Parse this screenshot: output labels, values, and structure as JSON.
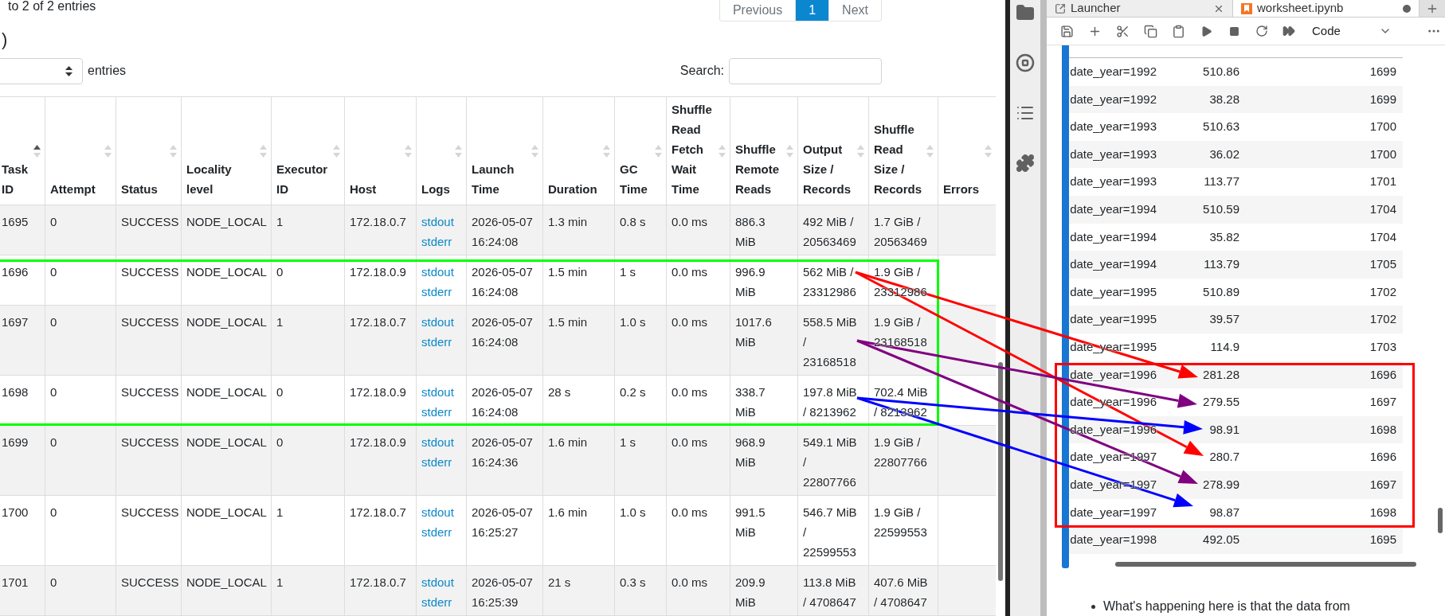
{
  "info": "to 2 of 2 entries",
  "pagination": [
    {
      "label": "Previous",
      "selected": false
    },
    {
      "label": "1",
      "selected": true
    },
    {
      "label": "Next",
      "selected": false
    }
  ],
  "heading": ")",
  "length_label": "entries",
  "search": {
    "label": "Search:"
  },
  "table": {
    "columns": [
      {
        "label": "Task ID",
        "kind": "text",
        "sorted": true
      },
      {
        "label": "Attempt",
        "kind": "text",
        "sorted": false
      },
      {
        "label": "Status",
        "kind": "text",
        "sorted": false
      },
      {
        "label": "Locality level",
        "kind": "text",
        "sorted": false
      },
      {
        "label": "Executor ID",
        "kind": "text",
        "sorted": false
      },
      {
        "label": "Host",
        "kind": "text",
        "sorted": false
      },
      {
        "label": "Logs",
        "kind": "links",
        "sorted": false
      },
      {
        "label": "Launch Time",
        "kind": "text",
        "sorted": false
      },
      {
        "label": "Duration",
        "kind": "text",
        "sorted": false
      },
      {
        "label": "GC Time",
        "kind": "text",
        "sorted": false
      },
      {
        "label": "Shuffle Read Fetch Wait Time",
        "kind": "text",
        "sorted": false
      },
      {
        "label": "Shuffle Remote Reads",
        "kind": "text",
        "sorted": false
      },
      {
        "label": "Output Size / Records",
        "kind": "text",
        "sorted": false
      },
      {
        "label": "Shuffle Read Size / Records",
        "kind": "text",
        "sorted": false
      },
      {
        "label": "Errors",
        "kind": "text",
        "sorted": false
      }
    ],
    "rows": [
      {
        "cells": [
          "1695",
          "0",
          "SUCCESS",
          "NODE_LOCAL",
          "1",
          "172.18.0.7",
          [
            "stdout",
            "stderr"
          ],
          "2026-05-07 16:24:08",
          "1.3 min",
          "0.8 s",
          "0.0 ms",
          "886.3 MiB",
          "492 MiB / 20563469",
          "1.7 GiB / 20563469"
        ]
      },
      {
        "cells": [
          "1696",
          "0",
          "SUCCESS",
          "NODE_LOCAL",
          "0",
          "172.18.0.9",
          [
            "stdout",
            "stderr"
          ],
          "2026-05-07 16:24:08",
          "1.5 min",
          "1 s",
          "0.0 ms",
          "996.9 MiB",
          "562 MiB / 23312986",
          "1.9 GiB / 23312986"
        ]
      },
      {
        "cells": [
          "1697",
          "0",
          "SUCCESS",
          "NODE_LOCAL",
          "1",
          "172.18.0.7",
          [
            "stdout",
            "stderr"
          ],
          "2026-05-07 16:24:08",
          "1.5 min",
          "1.0 s",
          "0.0 ms",
          "1017.6 MiB",
          "558.5 MiB / 23168518",
          "1.9 GiB / 23168518"
        ]
      },
      {
        "cells": [
          "1698",
          "0",
          "SUCCESS",
          "NODE_LOCAL",
          "0",
          "172.18.0.9",
          [
            "stdout",
            "stderr"
          ],
          "2026-05-07 16:24:08",
          "28 s",
          "0.2 s",
          "0.0 ms",
          "338.7 MiB",
          "197.8 MiB / 8213962",
          "702.4 MiB / 8213962"
        ]
      },
      {
        "cells": [
          "1699",
          "0",
          "SUCCESS",
          "NODE_LOCAL",
          "0",
          "172.18.0.9",
          [
            "stdout",
            "stderr"
          ],
          "2026-05-07 16:24:36",
          "1.6 min",
          "1 s",
          "0.0 ms",
          "968.9 MiB",
          "549.1 MiB / 22807766",
          "1.9 GiB / 22807766"
        ]
      },
      {
        "cells": [
          "1700",
          "0",
          "SUCCESS",
          "NODE_LOCAL",
          "1",
          "172.18.0.7",
          [
            "stdout",
            "stderr"
          ],
          "2026-05-07 16:25:27",
          "1.6 min",
          "1.0 s",
          "0.0 ms",
          "991.5 MiB",
          "546.7 MiB / 22599553",
          "1.9 GiB / 22599553"
        ]
      },
      {
        "cells": [
          "1701",
          "0",
          "SUCCESS",
          "NODE_LOCAL",
          "1",
          "172.18.0.7",
          [
            "stdout",
            "stderr"
          ],
          "2026-05-07 16:25:39",
          "21 s",
          "0.3 s",
          "0.0 ms",
          "209.9 MiB",
          "113.8 MiB / 4708647",
          "407.6 MiB / 4708647"
        ]
      }
    ]
  },
  "notebook": {
    "tabs": [
      {
        "label": "Launcher",
        "kind": "launcher",
        "selected": false,
        "unsaved": false
      },
      {
        "label": "worksheet.ipynb",
        "kind": "notebook",
        "selected": true,
        "unsaved": true
      }
    ],
    "toolbar": {
      "cell_type": "Code"
    },
    "rows": [
      {
        "partition": "date_year=1992",
        "size": "510.86",
        "task": "1699"
      },
      {
        "partition": "date_year=1992",
        "size": "38.28",
        "task": "1699"
      },
      {
        "partition": "date_year=1993",
        "size": "510.63",
        "task": "1700"
      },
      {
        "partition": "date_year=1993",
        "size": "36.02",
        "task": "1700"
      },
      {
        "partition": "date_year=1993",
        "size": "113.77",
        "task": "1701"
      },
      {
        "partition": "date_year=1994",
        "size": "510.59",
        "task": "1704"
      },
      {
        "partition": "date_year=1994",
        "size": "35.82",
        "task": "1704"
      },
      {
        "partition": "date_year=1994",
        "size": "113.79",
        "task": "1705"
      },
      {
        "partition": "date_year=1995",
        "size": "510.89",
        "task": "1702"
      },
      {
        "partition": "date_year=1995",
        "size": "39.57",
        "task": "1702"
      },
      {
        "partition": "date_year=1995",
        "size": "114.9",
        "task": "1703"
      },
      {
        "partition": "date_year=1996",
        "size": "281.28",
        "task": "1696"
      },
      {
        "partition": "date_year=1996",
        "size": "279.55",
        "task": "1697"
      },
      {
        "partition": "date_year=1996",
        "size": "98.91",
        "task": "1698"
      },
      {
        "partition": "date_year=1997",
        "size": "280.7",
        "task": "1696"
      },
      {
        "partition": "date_year=1997",
        "size": "278.99",
        "task": "1697"
      },
      {
        "partition": "date_year=1997",
        "size": "98.87",
        "task": "1698"
      },
      {
        "partition": "date_year=1998",
        "size": "492.05",
        "task": "1695"
      }
    ],
    "note": "What's happening here is that the data from"
  },
  "annotations": {
    "boxes": [
      {
        "color": "#00ff00"
      },
      {
        "color": "#ff0000"
      }
    ],
    "arrows": [
      {
        "color": "#ff0000"
      },
      {
        "color": "#ff0000"
      },
      {
        "color": "#800080"
      },
      {
        "color": "#800080"
      },
      {
        "color": "#0000ff"
      },
      {
        "color": "#0000ff"
      }
    ]
  }
}
